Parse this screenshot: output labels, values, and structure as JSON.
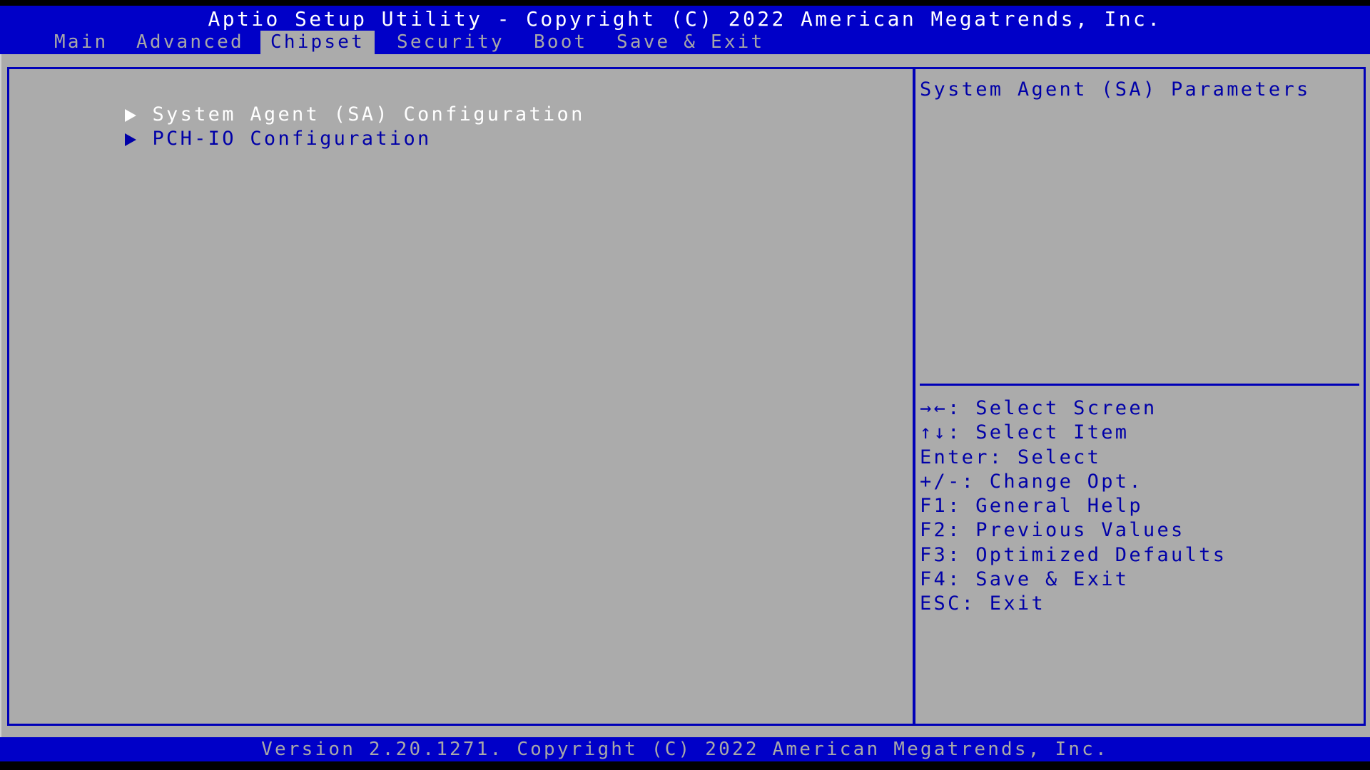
{
  "header": {
    "title": "Aptio Setup Utility - Copyright (C) 2022 American Megatrends, Inc."
  },
  "tabs": [
    {
      "label": "Main",
      "active": false
    },
    {
      "label": "Advanced",
      "active": false
    },
    {
      "label": "Chipset",
      "active": true
    },
    {
      "label": "Security",
      "active": false
    },
    {
      "label": "Boot",
      "active": false
    },
    {
      "label": "Save & Exit",
      "active": false
    }
  ],
  "menu": {
    "items": [
      {
        "label": "System Agent (SA) Configuration",
        "icon": "submenu-arrow-icon",
        "selected": true
      },
      {
        "label": "PCH-IO Configuration",
        "icon": "submenu-arrow-icon",
        "selected": false
      }
    ]
  },
  "help": {
    "description": "System Agent (SA) Parameters",
    "keys": [
      {
        "key": "→←",
        "action": "Select Screen"
      },
      {
        "key": "↑↓",
        "action": "Select Item"
      },
      {
        "key": "Enter",
        "action": "Select"
      },
      {
        "key": "+/-",
        "action": "Change Opt."
      },
      {
        "key": "F1",
        "action": "General Help"
      },
      {
        "key": "F2",
        "action": "Previous Values"
      },
      {
        "key": "F3",
        "action": "Optimized Defaults"
      },
      {
        "key": "F4",
        "action": "Save & Exit"
      },
      {
        "key": "ESC",
        "action": "Exit"
      }
    ]
  },
  "footer": {
    "text": "Version 2.20.1271. Copyright (C) 2022 American Megatrends, Inc."
  },
  "colors": {
    "header_bg": "#0000c8",
    "body_bg": "#ababab",
    "text_blue": "#0000a8",
    "text_inactive": "#a8a8a8",
    "text_selected": "#ffffff"
  }
}
